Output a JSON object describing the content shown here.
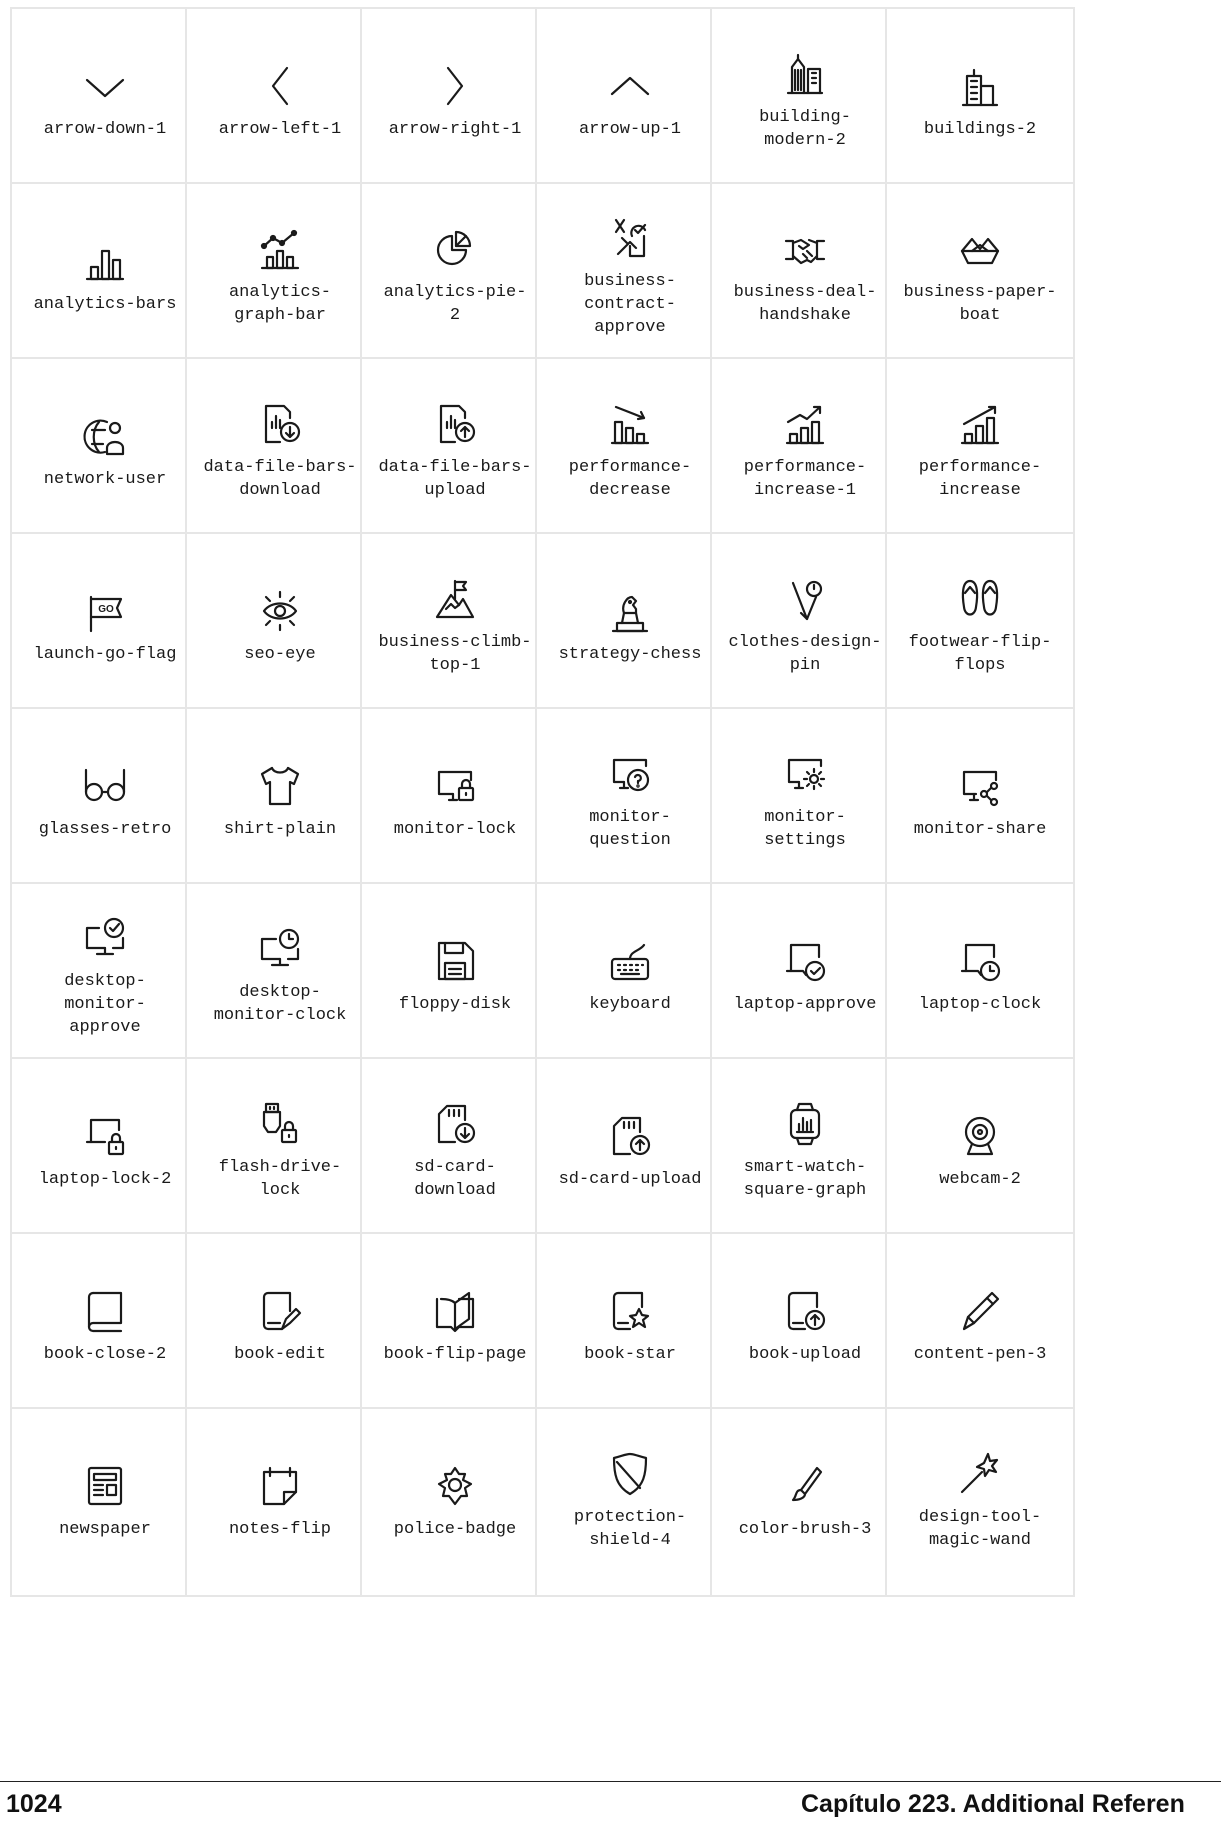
{
  "icons": [
    {
      "label": "arrow-down-1",
      "icon": "arrow-down-1-icon"
    },
    {
      "label": "arrow-left-1",
      "icon": "arrow-left-1-icon"
    },
    {
      "label": "arrow-right-1",
      "icon": "arrow-right-1-icon"
    },
    {
      "label": "arrow-up-1",
      "icon": "arrow-up-1-icon"
    },
    {
      "label": "building-\nmodern-2",
      "icon": "building-modern-2-icon"
    },
    {
      "label": "buildings-2",
      "icon": "buildings-2-icon"
    },
    {
      "label": "analytics-bars",
      "icon": "analytics-bars-icon"
    },
    {
      "label": "analytics-\ngraph-bar",
      "icon": "analytics-graph-bar-icon"
    },
    {
      "label": "analytics-pie-\n2",
      "icon": "analytics-pie-2-icon"
    },
    {
      "label": "business-\ncontract-\napprove",
      "icon": "business-contract-approve-icon"
    },
    {
      "label": "business-deal-\nhandshake",
      "icon": "business-deal-handshake-icon"
    },
    {
      "label": "business-paper-\nboat",
      "icon": "business-paper-boat-icon"
    },
    {
      "label": "network-user",
      "icon": "network-user-icon"
    },
    {
      "label": "data-file-bars-\ndownload",
      "icon": "data-file-bars-download-icon"
    },
    {
      "label": "data-file-bars-\nupload",
      "icon": "data-file-bars-upload-icon"
    },
    {
      "label": "performance-\ndecrease",
      "icon": "performance-decrease-icon"
    },
    {
      "label": "performance-\nincrease-1",
      "icon": "performance-increase-1-icon"
    },
    {
      "label": "performance-\nincrease",
      "icon": "performance-increase-icon"
    },
    {
      "label": "launch-go-flag",
      "icon": "launch-go-flag-icon",
      "icon_text": "GO"
    },
    {
      "label": "seo-eye",
      "icon": "seo-eye-icon"
    },
    {
      "label": "business-climb-\ntop-1",
      "icon": "business-climb-top-1-icon"
    },
    {
      "label": "strategy-chess",
      "icon": "strategy-chess-icon"
    },
    {
      "label": "clothes-design-\npin",
      "icon": "clothes-design-pin-icon"
    },
    {
      "label": "footwear-flip-\nflops",
      "icon": "footwear-flip-flops-icon"
    },
    {
      "label": "glasses-retro",
      "icon": "glasses-retro-icon"
    },
    {
      "label": "shirt-plain",
      "icon": "shirt-plain-icon"
    },
    {
      "label": "monitor-lock",
      "icon": "monitor-lock-icon"
    },
    {
      "label": "monitor-\nquestion",
      "icon": "monitor-question-icon"
    },
    {
      "label": "monitor-\nsettings",
      "icon": "monitor-settings-icon"
    },
    {
      "label": "monitor-share",
      "icon": "monitor-share-icon"
    },
    {
      "label": "desktop-\nmonitor-\napprove",
      "icon": "desktop-monitor-approve-icon"
    },
    {
      "label": "desktop-\nmonitor-clock",
      "icon": "desktop-monitor-clock-icon"
    },
    {
      "label": "floppy-disk",
      "icon": "floppy-disk-icon"
    },
    {
      "label": "keyboard",
      "icon": "keyboard-icon"
    },
    {
      "label": "laptop-approve",
      "icon": "laptop-approve-icon"
    },
    {
      "label": "laptop-clock",
      "icon": "laptop-clock-icon"
    },
    {
      "label": "laptop-lock-2",
      "icon": "laptop-lock-2-icon"
    },
    {
      "label": "flash-drive-\nlock",
      "icon": "flash-drive-lock-icon"
    },
    {
      "label": "sd-card-\ndownload",
      "icon": "sd-card-download-icon"
    },
    {
      "label": "sd-card-upload",
      "icon": "sd-card-upload-icon"
    },
    {
      "label": "smart-watch-\nsquare-graph",
      "icon": "smart-watch-square-graph-icon"
    },
    {
      "label": "webcam-2",
      "icon": "webcam-2-icon"
    },
    {
      "label": "book-close-2",
      "icon": "book-close-2-icon"
    },
    {
      "label": "book-edit",
      "icon": "book-edit-icon"
    },
    {
      "label": "book-flip-page",
      "icon": "book-flip-page-icon"
    },
    {
      "label": "book-star",
      "icon": "book-star-icon"
    },
    {
      "label": "book-upload",
      "icon": "book-upload-icon"
    },
    {
      "label": "content-pen-3",
      "icon": "content-pen-3-icon"
    },
    {
      "label": "newspaper",
      "icon": "newspaper-icon"
    },
    {
      "label": "notes-flip",
      "icon": "notes-flip-icon"
    },
    {
      "label": "police-badge",
      "icon": "police-badge-icon"
    },
    {
      "label": "protection-\nshield-4",
      "icon": "protection-shield-4-icon"
    },
    {
      "label": "color-brush-3",
      "icon": "color-brush-3-icon"
    },
    {
      "label": "design-tool-\nmagic-wand",
      "icon": "design-tool-magic-wand-icon"
    }
  ],
  "footer": {
    "page_number": "1024",
    "chapter": "Capítulo 223.  Additional Referen"
  },
  "colors": {
    "icon_stroke": "#1a1a1a",
    "cell_border": "#e6e6e6",
    "text": "#1a1a1a"
  }
}
